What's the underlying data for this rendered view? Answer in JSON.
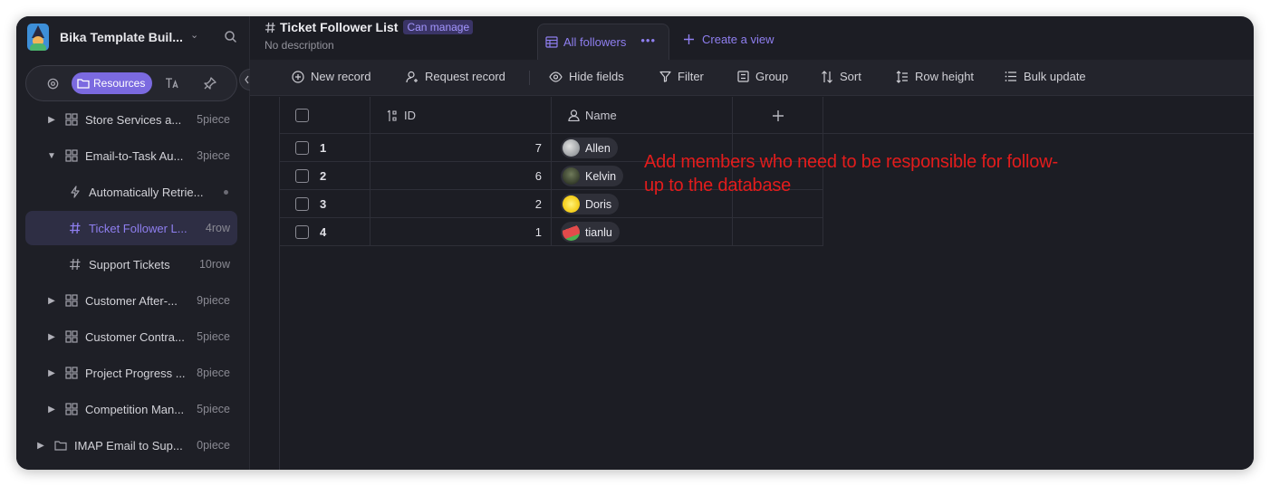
{
  "workspace": {
    "name": "Bika Template Buil..."
  },
  "sidebar_tabs": {
    "resources_label": "Resources"
  },
  "tree": [
    {
      "label": "Store Services a...",
      "count": "5piece",
      "type": "folder",
      "expanded": false
    },
    {
      "label": "Email-to-Task Au...",
      "count": "3piece",
      "type": "folder",
      "expanded": true
    },
    {
      "label": "Automatically Retrie...",
      "count": "",
      "type": "automation"
    },
    {
      "label": "Ticket Follower L...",
      "count": "4row",
      "type": "database",
      "active": true
    },
    {
      "label": "Support Tickets",
      "count": "10row",
      "type": "database"
    },
    {
      "label": "Customer After-...",
      "count": "9piece",
      "type": "folder",
      "expanded": false
    },
    {
      "label": "Customer Contra...",
      "count": "5piece",
      "type": "folder",
      "expanded": false
    },
    {
      "label": "Project Progress ...",
      "count": "8piece",
      "type": "folder",
      "expanded": false
    },
    {
      "label": "Competition Man...",
      "count": "5piece",
      "type": "folder",
      "expanded": false
    },
    {
      "label": "IMAP Email to Sup...",
      "count": "0piece",
      "type": "directory",
      "expanded": false
    }
  ],
  "header": {
    "title": "Ticket Follower List",
    "permission": "Can manage",
    "description": "No description"
  },
  "views": {
    "active_view": "All followers",
    "create_label": "Create a view"
  },
  "toolbar": {
    "new_record": "New record",
    "request_record": "Request record",
    "hide_fields": "Hide fields",
    "filter": "Filter",
    "group": "Group",
    "sort": "Sort",
    "row_height": "Row height",
    "bulk_update": "Bulk update"
  },
  "table": {
    "columns": [
      "ID",
      "Name"
    ],
    "rows": [
      {
        "num": "1",
        "id": "7",
        "name": "Allen",
        "avatar_color": "#9ea3a8"
      },
      {
        "num": "2",
        "id": "6",
        "name": "Kelvin",
        "avatar_color": "#2b3a2a"
      },
      {
        "num": "3",
        "id": "2",
        "name": "Doris",
        "avatar_color": "#f5d020"
      },
      {
        "num": "4",
        "id": "1",
        "name": "tianlu",
        "avatar_color": "#e24b4b"
      }
    ]
  },
  "annotation": {
    "text": "Add members who need to be responsible for follow-up to the database"
  },
  "colors": {
    "accent": "#8f7ff0",
    "annotation": "#e31c1c",
    "background": "#1c1d24"
  }
}
